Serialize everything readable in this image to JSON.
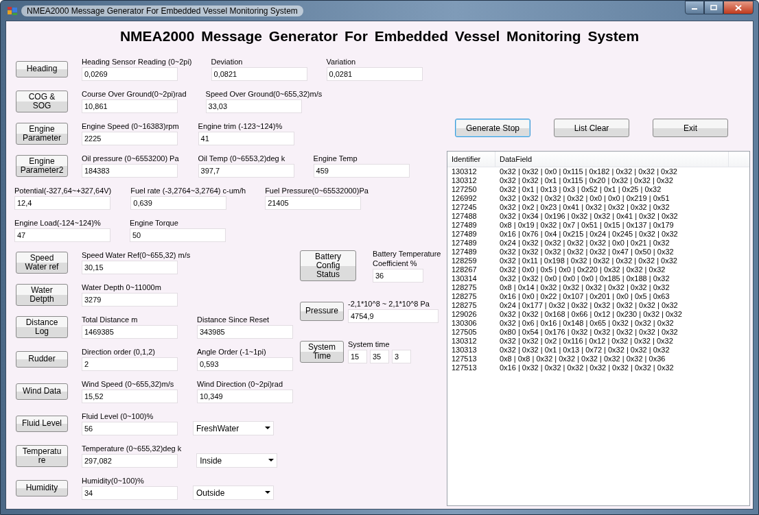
{
  "window": {
    "title": "NMEA2000 Message Generator For Embedded Vessel Monitoring System"
  },
  "heading": "NMEA2000 Message Generator For Embedded Vessel Monitoring System",
  "groups": [
    {
      "button": "Heading",
      "fields": [
        {
          "kind": "text",
          "label": "Heading Sensor Reading (0~2pi)",
          "value": "0,0269"
        },
        {
          "kind": "text",
          "label": "Deviation",
          "value": "0,0821"
        },
        {
          "kind": "text",
          "label": "Variation",
          "value": "0,0281"
        }
      ]
    },
    {
      "button": "COG &\nSOG",
      "fields": [
        {
          "kind": "text",
          "label": "Course Over Ground(0~2pi)rad",
          "value": "10,861"
        },
        {
          "kind": "text",
          "label": "Speed Over Ground(0~655,32)m/s",
          "value": "33,03"
        }
      ]
    },
    {
      "button": "Engine\nParameter",
      "fields": [
        {
          "kind": "text",
          "label": "Engine Speed (0~16383)rpm",
          "value": "2225"
        },
        {
          "kind": "text",
          "label": "Engine trim (-123~124)%",
          "value": "41"
        }
      ]
    },
    {
      "button": "Engine\nParameter2",
      "fields": [
        {
          "kind": "text",
          "label": "Oil pressure (0~6553200) Pa",
          "value": "184383"
        },
        {
          "kind": "text",
          "label": "Oil Temp (0~6553,2)deg k",
          "value": "397,7"
        },
        {
          "kind": "text",
          "label": "Engine Temp",
          "value": "459"
        }
      ]
    },
    {
      "fields": [
        {
          "kind": "text",
          "label": "Potential(-327,64~+327,64V)",
          "value": "12,4"
        },
        {
          "kind": "text",
          "label": "Fuel rate (-3,2764~3,2764) c-um/h",
          "value": "0,639"
        },
        {
          "kind": "text",
          "label": "Fuel Pressure(0~65532000)Pa",
          "value": "21405"
        }
      ]
    },
    {
      "fields": [
        {
          "kind": "text",
          "label": "Engine Load(-124~124)%",
          "value": "47"
        },
        {
          "kind": "text",
          "label": "Engine Torque",
          "value": "50"
        }
      ]
    },
    {
      "button": "Speed\nWater ref",
      "fields": [
        {
          "kind": "text",
          "label": "Speed Water Ref(0~655,32) m/s",
          "value": "30,15"
        }
      ]
    },
    {
      "button": "Water\nDetpth",
      "fields": [
        {
          "kind": "text",
          "label": "Water Depth 0~11000m",
          "value": "3279"
        }
      ]
    },
    {
      "button": "Distance\nLog",
      "fields": [
        {
          "kind": "text",
          "label": "Total Distance m",
          "value": "1469385"
        },
        {
          "kind": "text",
          "label": "Distance Since Reset",
          "value": "343985"
        }
      ]
    },
    {
      "button": "Rudder",
      "fields": [
        {
          "kind": "text",
          "label": "Direction order (0,1,2)",
          "value": "2"
        },
        {
          "kind": "text",
          "label": "Angle Order (-1~1pi)",
          "value": "0,593"
        }
      ]
    },
    {
      "button": "Wind Data",
      "fields": [
        {
          "kind": "text",
          "label": "Wind Speed (0~655,32)m/s",
          "value": "15,52"
        },
        {
          "kind": "text",
          "label": "Wind Direction (0~2pi)rad",
          "value": "10,349"
        }
      ]
    },
    {
      "button": "Fluid Level",
      "fields": [
        {
          "kind": "text",
          "label": "Fluid Level (0~100)%",
          "value": "56"
        },
        {
          "kind": "dropdown",
          "value": "FreshWater"
        }
      ]
    },
    {
      "button": "Temperatu\nre",
      "fields": [
        {
          "kind": "text",
          "label": "Temperature (0~655,32)deg k",
          "value": "297,082"
        },
        {
          "kind": "dropdown",
          "value": "Inside"
        }
      ]
    },
    {
      "button": "Humidity",
      "fields": [
        {
          "kind": "text",
          "label": "Humidity(0~100)%",
          "value": "34"
        },
        {
          "kind": "dropdown",
          "value": "Outside"
        }
      ]
    }
  ],
  "side_groups": [
    {
      "button": "Battery Config\nStatus",
      "fields": [
        {
          "kind": "small",
          "label": "Battery Temperature\nCoefficient %",
          "value": "36"
        }
      ]
    },
    {
      "button": "Pressure",
      "fields": [
        {
          "kind": "text",
          "label": "-2,1*10^8 ~ 2,1*10^8 Pa",
          "value": "4754,9"
        }
      ]
    },
    {
      "button": "System\nTime",
      "fields": [
        {
          "kind": "multi",
          "label": "System time",
          "values": [
            "15",
            "35",
            "3"
          ]
        }
      ]
    }
  ],
  "actions": [
    {
      "label": "Generate Stop",
      "focused": true
    },
    {
      "label": "List Clear",
      "focused": false
    },
    {
      "label": "Exit",
      "focused": false
    }
  ],
  "message_list": {
    "columns": [
      "Identifier",
      "DataField"
    ],
    "rows": [
      [
        "130312",
        "0x32 | 0x32 | 0x0 | 0x115 | 0x182 | 0x32 | 0x32 | 0x32"
      ],
      [
        "130312",
        "0x32 | 0x32 | 0x1 | 0x115 | 0x20 | 0x32 | 0x32 | 0x32"
      ],
      [
        "127250",
        "0x32 | 0x1 | 0x13 | 0x3 | 0x52 | 0x1 | 0x25 | 0x32"
      ],
      [
        "126992",
        "0x32 | 0x32 | 0x32 | 0x32 | 0x0 | 0x0 | 0x219 | 0x51"
      ],
      [
        "127245",
        "0x32 | 0x2 | 0x23 | 0x41 | 0x32 | 0x32 | 0x32 | 0x32"
      ],
      [
        "127488",
        "0x32 | 0x34 | 0x196 | 0x32 | 0x32 | 0x41 | 0x32 | 0x32"
      ],
      [
        "127489",
        "0x8 | 0x19 | 0x32 | 0x7 | 0x51 | 0x15 | 0x137 | 0x179"
      ],
      [
        "127489",
        "0x16 | 0x76 | 0x4 | 0x215 | 0x24 | 0x245 | 0x32 | 0x32"
      ],
      [
        "127489",
        "0x24 | 0x32 | 0x32 | 0x32 | 0x32 | 0x0 | 0x21 | 0x32"
      ],
      [
        "127489",
        "0x32 | 0x32 | 0x32 | 0x32 | 0x32 | 0x47 | 0x50 | 0x32"
      ],
      [
        "128259",
        "0x32 | 0x11 | 0x198 | 0x32 | 0x32 | 0x32 | 0x32 | 0x32"
      ],
      [
        "128267",
        "0x32 | 0x0 | 0x5 | 0x0 | 0x220 | 0x32 | 0x32 | 0x32"
      ],
      [
        "130314",
        "0x32 | 0x32 | 0x0 | 0x0 | 0x0 | 0x185 | 0x188 | 0x32"
      ],
      [
        "128275",
        "0x8 | 0x14 | 0x32 | 0x32 | 0x32 | 0x32 | 0x32 | 0x32"
      ],
      [
        "128275",
        "0x16 | 0x0 | 0x22 | 0x107 | 0x201 | 0x0 | 0x5 | 0x63"
      ],
      [
        "128275",
        "0x24 | 0x177 | 0x32 | 0x32 | 0x32 | 0x32 | 0x32 | 0x32"
      ],
      [
        "129026",
        "0x32 | 0x32 | 0x168 | 0x66 | 0x12 | 0x230 | 0x32 | 0x32"
      ],
      [
        "130306",
        "0x32 | 0x6 | 0x16 | 0x148 | 0x65 | 0x32 | 0x32 | 0x32"
      ],
      [
        "127505",
        "0x80 | 0x54 | 0x176 | 0x32 | 0x32 | 0x32 | 0x32 | 0x32"
      ],
      [
        "130312",
        "0x32 | 0x32 | 0x2 | 0x116 | 0x12 | 0x32 | 0x32 | 0x32"
      ],
      [
        "130313",
        "0x32 | 0x32 | 0x1 | 0x13 | 0x72 | 0x32 | 0x32 | 0x32"
      ],
      [
        "127513",
        "0x8 | 0x8 | 0x32 | 0x32 | 0x32 | 0x32 | 0x32 | 0x36"
      ],
      [
        "127513",
        "0x16 | 0x32 | 0x32 | 0x32 | 0x32 | 0x32 | 0x32 | 0x32"
      ]
    ]
  }
}
